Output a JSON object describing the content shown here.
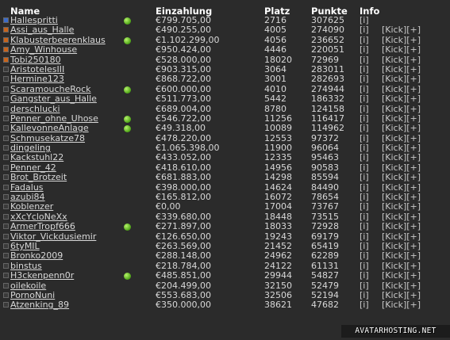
{
  "headers": {
    "name": "Name",
    "einzahlung": "Einzahlung",
    "platz": "Platz",
    "punkte": "Punkte",
    "info": "Info"
  },
  "colors": {
    "online_dot": "#5cb51c",
    "square_default": "#3a3a3a",
    "square_blue": "#3b6bc8",
    "square_orange": "#c7641c"
  },
  "rows": [
    {
      "name": "Hallespritti",
      "amount": "€799.705,00",
      "platz": "2716",
      "punkte": "307625",
      "info": "[i]",
      "kick": "",
      "online": true,
      "square": "#3b6bc8"
    },
    {
      "name": "Assi_aus_Halle",
      "amount": "€490.255,00",
      "platz": "4005",
      "punkte": "274090",
      "info": "[i]",
      "kick": "[Kick][+]",
      "online": false,
      "square": "#c7641c"
    },
    {
      "name": "Klabusterbeerenklaus",
      "amount": "€1.102.299,00",
      "platz": "4056",
      "punkte": "236652",
      "info": "[i]",
      "kick": "[Kick][+]",
      "online": true,
      "square": "#c7641c"
    },
    {
      "name": "Amy_Winhouse",
      "amount": "€950.424,00",
      "platz": "4446",
      "punkte": "220051",
      "info": "[i]",
      "kick": "[Kick][+]",
      "online": false,
      "square": "#c7641c"
    },
    {
      "name": "Tobi250180",
      "amount": "€528.000,00",
      "platz": "18020",
      "punkte": "72969",
      "info": "[i]",
      "kick": "[Kick][+]",
      "online": false,
      "square": "#c7641c"
    },
    {
      "name": "AristotelesIII",
      "amount": "€903.315,00",
      "platz": "3064",
      "punkte": "283011",
      "info": "[i]",
      "kick": "[Kick][+]",
      "online": false,
      "square": "#3a3a3a"
    },
    {
      "name": "Hermine123",
      "amount": "€868.722,00",
      "platz": "3001",
      "punkte": "282693",
      "info": "[i]",
      "kick": "[Kick][+]",
      "online": false,
      "square": "#3a3a3a"
    },
    {
      "name": "ScaramoucheRock",
      "amount": "€600.000,00",
      "platz": "4010",
      "punkte": "274944",
      "info": "[i]",
      "kick": "[Kick][+]",
      "online": true,
      "square": "#3a3a3a"
    },
    {
      "name": "Gangster_aus_Halle",
      "amount": "€511.773,00",
      "platz": "5442",
      "punkte": "186332",
      "info": "[i]",
      "kick": "[Kick][+]",
      "online": false,
      "square": "#3a3a3a"
    },
    {
      "name": "derschlucki",
      "amount": "€689.004,00",
      "platz": "8780",
      "punkte": "124158",
      "info": "[i]",
      "kick": "[Kick][+]",
      "online": false,
      "square": "#3a3a3a"
    },
    {
      "name": "Penner_ohne_Uhose",
      "amount": "€546.722,00",
      "platz": "11256",
      "punkte": "116417",
      "info": "[i]",
      "kick": "[Kick][+]",
      "online": true,
      "square": "#3a3a3a"
    },
    {
      "name": "KallevonneAnlage",
      "amount": "€49.318,00",
      "platz": "10089",
      "punkte": "114962",
      "info": "[i]",
      "kick": "[Kick][+]",
      "online": true,
      "square": "#3a3a3a"
    },
    {
      "name": "Schmusekatze78",
      "amount": "€478.220,00",
      "platz": "12553",
      "punkte": "97372",
      "info": "[i]",
      "kick": "[Kick][+]",
      "online": false,
      "square": "#3a3a3a"
    },
    {
      "name": "dingeling",
      "amount": "€1.065.398,00",
      "platz": "11900",
      "punkte": "96064",
      "info": "[i]",
      "kick": "[Kick][+]",
      "online": false,
      "square": "#3a3a3a"
    },
    {
      "name": "Kackstuhl22",
      "amount": "€433.052,00",
      "platz": "12335",
      "punkte": "95463",
      "info": "[i]",
      "kick": "[Kick][+]",
      "online": false,
      "square": "#3a3a3a"
    },
    {
      "name": "Penner_42",
      "amount": "€418.610,00",
      "platz": "14956",
      "punkte": "90583",
      "info": "[i]",
      "kick": "[Kick][+]",
      "online": false,
      "square": "#3a3a3a"
    },
    {
      "name": "Brot_Brotzeit",
      "amount": "€681.883,00",
      "platz": "14298",
      "punkte": "85594",
      "info": "[i]",
      "kick": "[Kick][+]",
      "online": false,
      "square": "#3a3a3a"
    },
    {
      "name": "Fadalus",
      "amount": "€398.000,00",
      "platz": "14624",
      "punkte": "84490",
      "info": "[i]",
      "kick": "[Kick][+]",
      "online": false,
      "square": "#3a3a3a"
    },
    {
      "name": "azubi84",
      "amount": "€165.812,00",
      "platz": "16072",
      "punkte": "78654",
      "info": "[i]",
      "kick": "[Kick][+]",
      "online": false,
      "square": "#3a3a3a"
    },
    {
      "name": "Koblenzer",
      "amount": "€0,00",
      "platz": "17004",
      "punkte": "73767",
      "info": "[i]",
      "kick": "[Kick][+]",
      "online": false,
      "square": "#3a3a3a"
    },
    {
      "name": "xXcYcloNeXx",
      "amount": "€339.680,00",
      "platz": "18448",
      "punkte": "73515",
      "info": "[i]",
      "kick": "[Kick][+]",
      "online": false,
      "square": "#3a3a3a"
    },
    {
      "name": "ArmerTropf666",
      "amount": "€271.897,00",
      "platz": "18033",
      "punkte": "72928",
      "info": "[i]",
      "kick": "[Kick][+]",
      "online": true,
      "square": "#3a3a3a"
    },
    {
      "name": "Viktor_Vickdusiemir",
      "amount": "€126.650,00",
      "platz": "19243",
      "punkte": "69179",
      "info": "[i]",
      "kick": "[Kick][+]",
      "online": false,
      "square": "#3a3a3a"
    },
    {
      "name": "6tyMIL",
      "amount": "€263.569,00",
      "platz": "21452",
      "punkte": "65419",
      "info": "[i]",
      "kick": "[Kick][+]",
      "online": false,
      "square": "#3a3a3a"
    },
    {
      "name": "Bronko2009",
      "amount": "€288.148,00",
      "platz": "24962",
      "punkte": "62289",
      "info": "[i]",
      "kick": "[Kick][+]",
      "online": false,
      "square": "#3a3a3a"
    },
    {
      "name": "binstus",
      "amount": "€218.784,00",
      "platz": "24122",
      "punkte": "61131",
      "info": "[i]",
      "kick": "[Kick][+]",
      "online": false,
      "square": "#3a3a3a"
    },
    {
      "name": "H3ckenpenn0r",
      "amount": "€485.851,00",
      "platz": "29944",
      "punkte": "54827",
      "info": "[i]",
      "kick": "[Kick][+]",
      "online": true,
      "square": "#3a3a3a"
    },
    {
      "name": "oilekoile",
      "amount": "€204.499,00",
      "platz": "32150",
      "punkte": "52479",
      "info": "[i]",
      "kick": "[Kick][+]",
      "online": false,
      "square": "#3a3a3a"
    },
    {
      "name": "PornoNuni",
      "amount": "€553.683,00",
      "platz": "32506",
      "punkte": "52194",
      "info": "[i]",
      "kick": "[Kick][+]",
      "online": false,
      "square": "#3a3a3a"
    },
    {
      "name": "Atzenking_89",
      "amount": "€350.000,00",
      "platz": "38621",
      "punkte": "47682",
      "info": "[i]",
      "kick": "[Kick][+]",
      "online": false,
      "square": "#3a3a3a"
    }
  ],
  "watermark": "AVATARHOSTING.NET"
}
